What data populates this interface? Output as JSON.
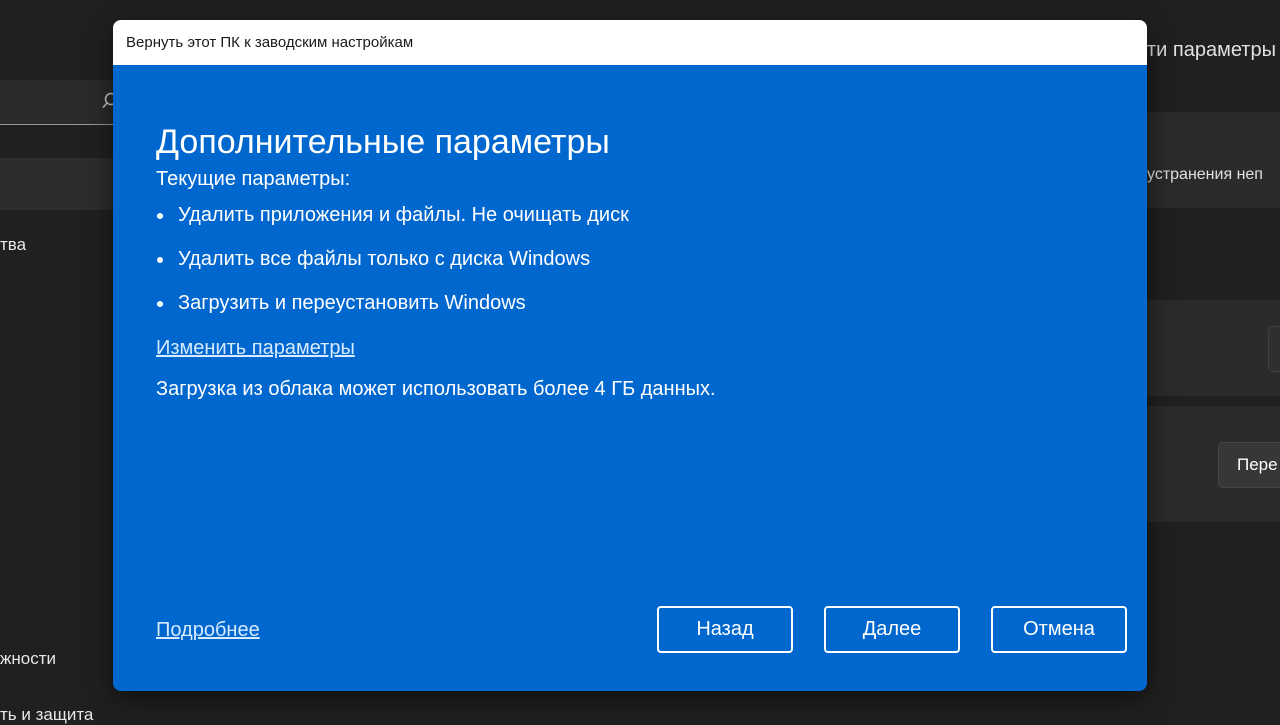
{
  "background": {
    "right_header_text": "ти параметры",
    "right_row_text": "устранения неп",
    "side_item_1": "тва",
    "side_item_2": "жности",
    "side_item_3": "ть и защита",
    "reset_button_label": "Пере"
  },
  "dialog": {
    "title": "Вернуть этот ПК к заводским настройкам",
    "heading": "Дополнительные параметры",
    "current_label": "Текущие параметры:",
    "bullets": [
      "Удалить приложения и файлы. Не очищать диск",
      "Удалить все файлы только с диска Windows",
      "Загрузить и переустановить Windows"
    ],
    "change_settings_link": "Изменить параметры",
    "cloud_note": "Загрузка из облака может использовать более 4 ГБ данных.",
    "learn_more_link": "Подробнее",
    "buttons": {
      "back": "Назад",
      "next": "Далее",
      "cancel": "Отмена"
    }
  },
  "colors": {
    "dialog_blue": "#0067cf",
    "background": "#202020"
  }
}
